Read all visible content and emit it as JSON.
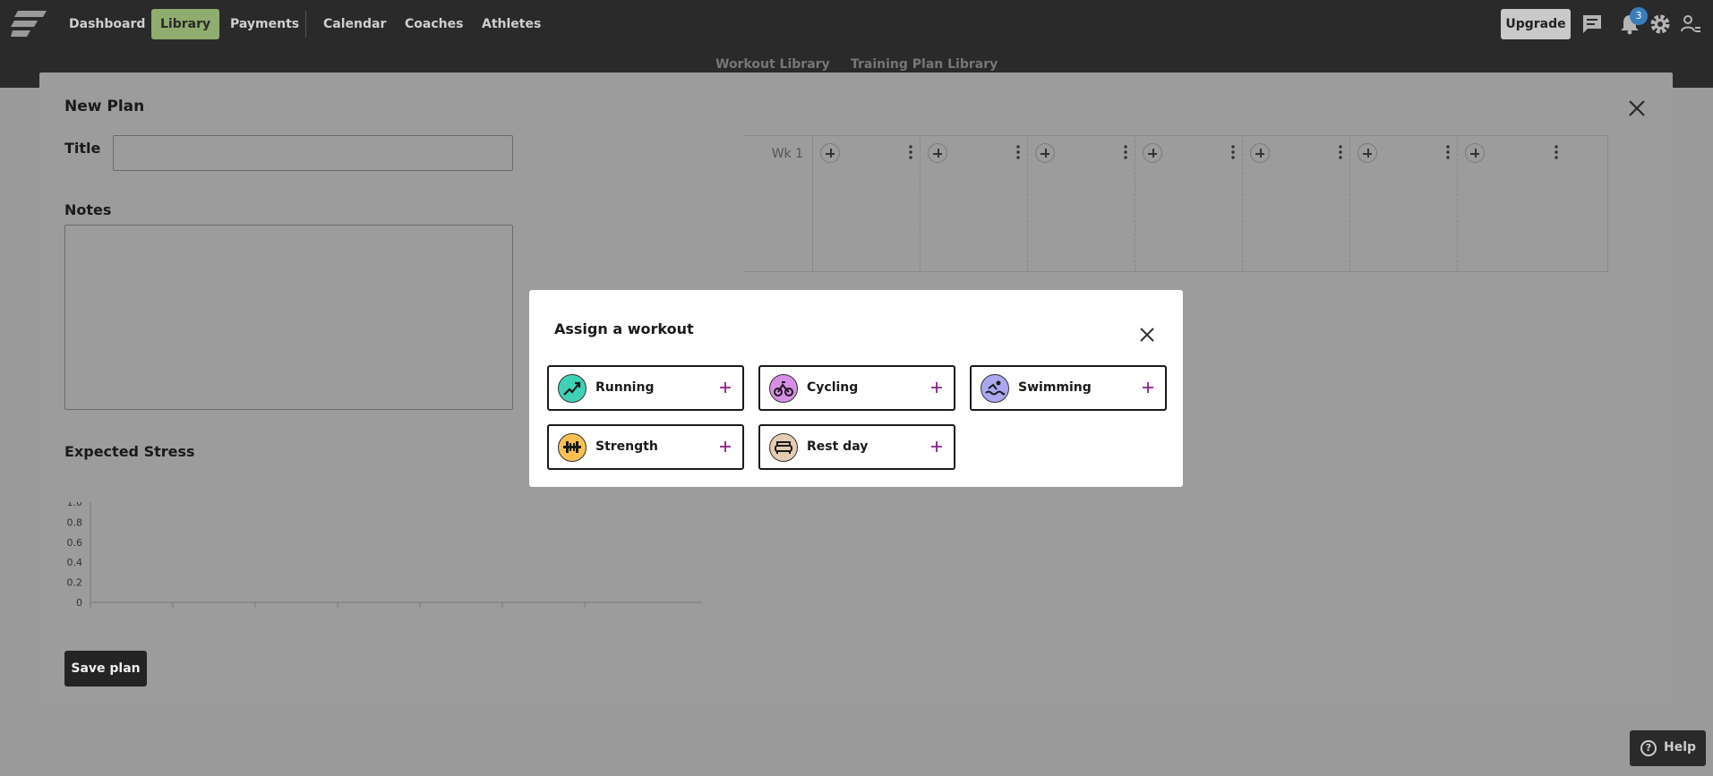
{
  "nav": {
    "items": [
      {
        "label": "Dashboard",
        "active": false
      },
      {
        "label": "Library",
        "active": true
      },
      {
        "label": "Payments",
        "active": false
      },
      {
        "label": "Calendar",
        "active": false
      },
      {
        "label": "Coaches",
        "active": false
      },
      {
        "label": "Athletes",
        "active": false
      }
    ],
    "upgrade_label": "Upgrade",
    "notification_count": "3",
    "accent_color": "#8fad6e"
  },
  "subtabs": [
    "Workout Library",
    "Training Plan Library"
  ],
  "plan_modal": {
    "title": "New Plan",
    "title_label": "Title",
    "title_value": "",
    "notes_label": "Notes",
    "notes_value": "",
    "stress_label": "Expected Stress",
    "save_label": "Save plan"
  },
  "stress_chart": {
    "y_ticks": [
      "1.0",
      "0.8",
      "0.6",
      "0.4",
      "0.2",
      "0"
    ]
  },
  "week_grid": {
    "week_label": "Wk 1",
    "day_count": 7
  },
  "assign": {
    "title": "Assign a workout",
    "options": [
      {
        "label": "Running",
        "icon": "running-icon",
        "color": "#3fd1b3"
      },
      {
        "label": "Cycling",
        "icon": "cycling-icon",
        "color": "#d98ee6"
      },
      {
        "label": "Swimming",
        "icon": "swimming-icon",
        "color": "#a9a8f0"
      },
      {
        "label": "Strength",
        "icon": "strength-icon",
        "color": "#fbbf52"
      },
      {
        "label": "Rest day",
        "icon": "rest-day-icon",
        "color": "#e5cbb4"
      }
    ],
    "plus_color": "#8a1e8a"
  },
  "help": {
    "label": "Help"
  }
}
